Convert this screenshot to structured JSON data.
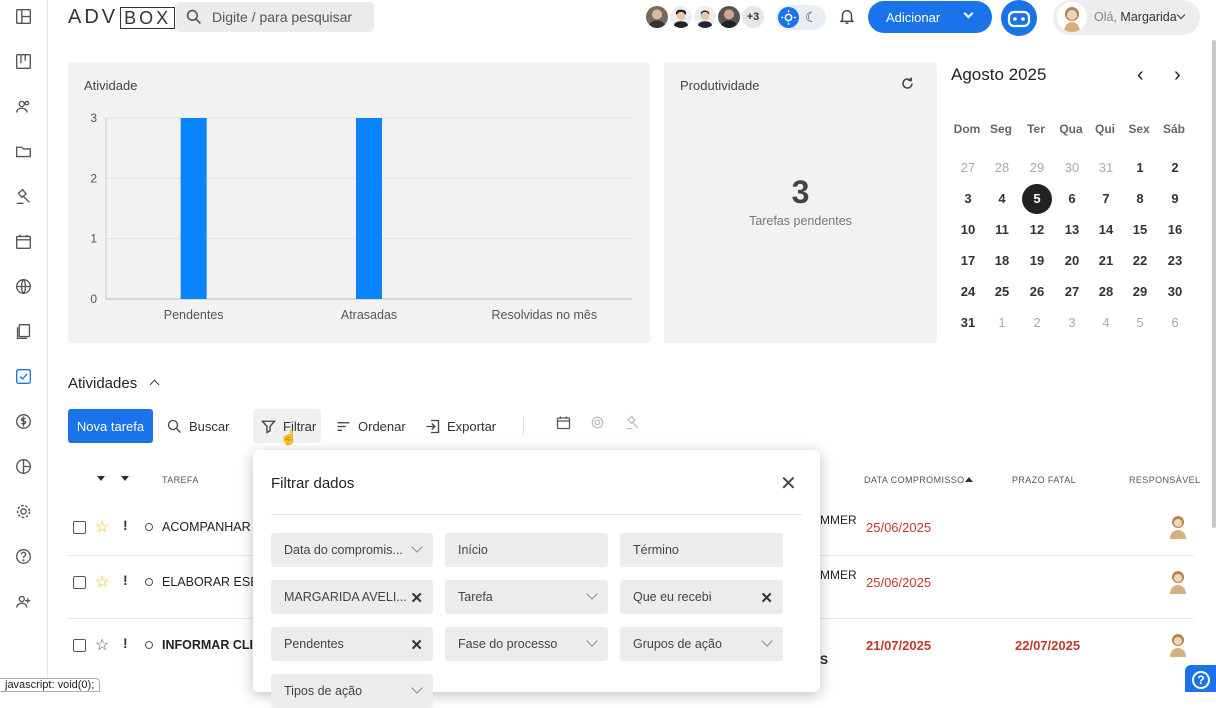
{
  "brand": {
    "logo_left": "ADV",
    "logo_right": "BOX"
  },
  "search": {
    "placeholder": "Digite / para pesquisar"
  },
  "header": {
    "avatars_more": "+3",
    "add_label": "Adicionar",
    "greeting_prefix": "Olá,",
    "user_name": "Margarida"
  },
  "sidebar": {
    "items": [
      "dashboard-icon",
      "kanban-icon",
      "people-icon",
      "folder-icon",
      "gavel-icon",
      "calendar-icon",
      "globe-icon",
      "documents-icon",
      "tasks-icon",
      "finance-icon",
      "chart-pie-icon",
      "settings-icon",
      "help-icon",
      "add-user-icon"
    ]
  },
  "activity_card": {
    "title": "Atividade"
  },
  "productivity_card": {
    "title": "Produtividade",
    "value": "3",
    "caption": "Tarefas pendentes"
  },
  "chart_data": {
    "type": "bar",
    "categories": [
      "Pendentes",
      "Atrasadas",
      "Resolvidas no mês"
    ],
    "values": [
      3,
      3,
      0
    ],
    "yticks": [
      "0",
      "1",
      "2",
      "3"
    ],
    "ylim": [
      0,
      3
    ],
    "color": "#0a84ff",
    "grid": true
  },
  "calendar": {
    "month": "Agosto 2025",
    "weekdays": [
      "Dom",
      "Seg",
      "Ter",
      "Qua",
      "Qui",
      "Sex",
      "Sáb"
    ],
    "weeks": [
      [
        "27",
        "28",
        "29",
        "30",
        "31",
        "1",
        "2"
      ],
      [
        "3",
        "4",
        "5",
        "6",
        "7",
        "8",
        "9"
      ],
      [
        "10",
        "11",
        "12",
        "13",
        "14",
        "15",
        "16"
      ],
      [
        "17",
        "18",
        "19",
        "20",
        "21",
        "22",
        "23"
      ],
      [
        "24",
        "25",
        "26",
        "27",
        "28",
        "29",
        "30"
      ],
      [
        "31",
        "1",
        "2",
        "3",
        "4",
        "5",
        "6"
      ]
    ],
    "today": "5"
  },
  "activities": {
    "title": "Atividades",
    "toolbar": {
      "new_task": "Nova tarefa",
      "search": "Buscar",
      "filter": "Filtrar",
      "sort": "Ordenar",
      "export": "Exportar"
    },
    "columns": {
      "task": "TAREFA",
      "due": "DATA COMPROMISSO",
      "deadline": "PRAZO FATAL",
      "owner": "RESPONSÁVEL"
    },
    "rows": [
      {
        "task": "ACOMPANHAR",
        "extra": "MMER",
        "due": "25/06/2025",
        "deadline": "",
        "starred": true
      },
      {
        "task": "ELABORAR ESB",
        "extra": "MMER",
        "due": "25/06/2025",
        "deadline": "",
        "starred": true
      },
      {
        "task": "INFORMAR CLI",
        "extra": "S",
        "due": "21/07/2025",
        "deadline": "22/07/2025",
        "starred": false
      }
    ]
  },
  "filter_modal": {
    "title": "Filtrar dados",
    "fields": [
      {
        "label": "Data do compromis...",
        "kind": "select"
      },
      {
        "label": "Início",
        "kind": "input"
      },
      {
        "label": "Término",
        "kind": "input"
      },
      {
        "label": "MARGARIDA AVELI...",
        "kind": "clear"
      },
      {
        "label": "Tarefa",
        "kind": "select"
      },
      {
        "label": "Que eu recebi",
        "kind": "clear"
      },
      {
        "label": "Pendentes",
        "kind": "clear"
      },
      {
        "label": "Fase do processo",
        "kind": "select"
      },
      {
        "label": "Grupos de ação",
        "kind": "select"
      },
      {
        "label": "Tipos de ação",
        "kind": "select"
      }
    ]
  },
  "statusbar": {
    "text": "javascript: void(0);"
  }
}
